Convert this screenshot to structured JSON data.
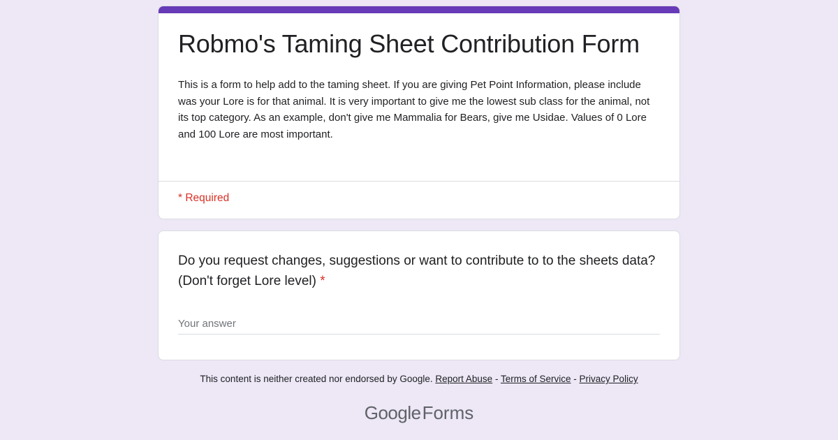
{
  "form": {
    "title": "Robmo's Taming Sheet Contribution Form",
    "description": "This is a form to help add to the taming sheet. If you are giving Pet Point Information, please include was your Lore is for that animal. It is very important to give me the lowest sub class for the animal, not its top category. As an example, don't give me Mammalia for Bears, give me Usidae. Values of 0 Lore and 100 Lore are most important.",
    "required_note": "* Required",
    "accent_color": "#673ab7"
  },
  "question": {
    "title": "Do you request changes, suggestions or want to contribute to to the sheets data? (Don't forget Lore level)",
    "required_star": "*",
    "answer_placeholder": "Your answer",
    "answer_value": ""
  },
  "footer": {
    "disclaimer": "This content is neither created nor endorsed by Google.",
    "report_abuse": "Report Abuse",
    "sep1": "-",
    "terms": "Terms of Service",
    "sep2": "-",
    "privacy": "Privacy Policy"
  },
  "brand": {
    "google": "Google",
    "forms": "Forms"
  }
}
